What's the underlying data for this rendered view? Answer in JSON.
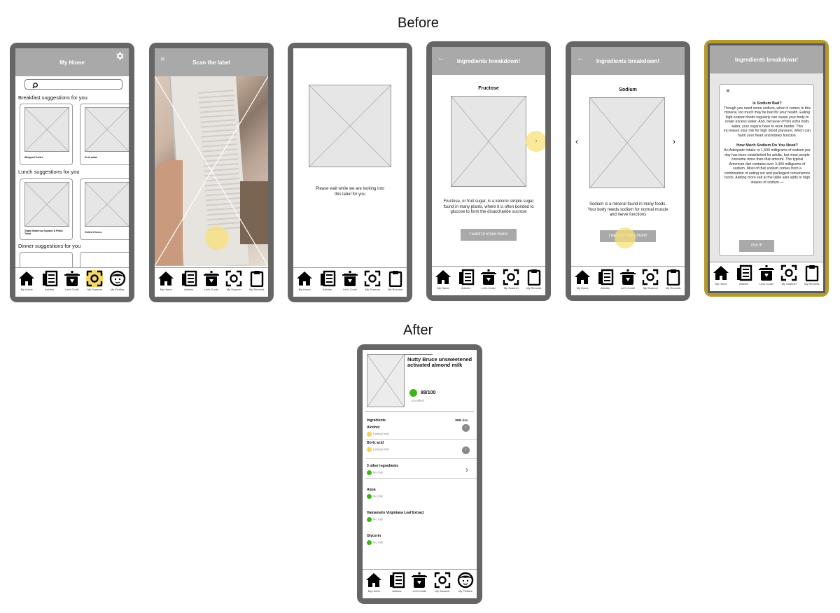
{
  "headings": {
    "before": "Before",
    "after": "After"
  },
  "nav": {
    "home": "My Home",
    "articles": "Articles",
    "cook": "Let's Cook!",
    "scanner": "My Scanner",
    "profiles": "My Profiles",
    "records": "My Records"
  },
  "screens": {
    "home": {
      "title": "My Home",
      "breakfast": "Breakfast suggestions for you",
      "lunch": "Lunch suggestions for you",
      "dinner": "Dinner suggestions for you",
      "breakfast_items": [
        "Whipped Coffee",
        "Fruit salad"
      ],
      "lunch_items": [
        "Vegan Butternut Squash & Pistio Toast",
        "Grilled Cheese"
      ]
    },
    "scan": {
      "title": "Scan the label",
      "close": "×"
    },
    "loading": {
      "message": "Please wait while we are looking into this label for you"
    },
    "fructose": {
      "title": "Ingredients breakdown!",
      "back": "←",
      "name": "Fructose",
      "description": "Fructose, or fruit sugar, is a ketonic simple sugar found in many plants, where it is often bonded to glucose to form the disaccharide sucrose",
      "button": "I want to know more!",
      "arrow": "›"
    },
    "sodium": {
      "title": "Ingredients breakdown!",
      "back": "←",
      "name": "Sodium",
      "description": "Sodium is a mineral found in many foods. Your body needs sodium for normal muscle and nerve functions",
      "button": "I want to know more!",
      "prev": "‹",
      "next": "›"
    },
    "detail": {
      "title": "Ingredients breakdown!",
      "close": "×",
      "q1": "Is Sodium Bad?",
      "p1": "Though you need some sodium, when it comes to this mineral, too much may be bad for your health. Eating high-sodium foods regularly can cause your body to retain excess water. And, because of this extra body water, your organs have to work harder. This increases your risk for high blood pressure, which can harm your heart and kidney function.",
      "q2": "How Much Sodium Do You Need?",
      "p2": "An Adequate Intake or 1,500 milligrams of sodium per day has been established for adults, but most people consume more than that amount. The typical American diet contains over 3,400 milligrams of sodium. Most of that sodium comes from a combination of eating out and packaged convenience foods. Adding more salt at the table also adds to high intakes of sodium —",
      "button": "Got it!"
    },
    "after": {
      "product": "Nutty Bruce unsweetened activated almond milk",
      "score": "88/100",
      "rating": "Excellent",
      "ingredients_label": "Ingredients",
      "see_all": "SEE ALL",
      "info": "i",
      "items": [
        {
          "name": "Alcohol",
          "risk": "Limited risk",
          "color": "#f4cf5c"
        },
        {
          "name": "Boric acid",
          "risk": "Limited risk",
          "color": "#f4cf5c"
        },
        {
          "name": "3 other ingredients",
          "risk": "No risk",
          "color": "#3fb518"
        },
        {
          "name": "Aqua",
          "risk": "No risk",
          "color": "#3fb518"
        },
        {
          "name": "Hamamelis Virginiana Leaf Extract",
          "risk": "No risk",
          "color": "#3fb518"
        },
        {
          "name": "Glycerin",
          "risk": "No risk",
          "color": "#3fb518"
        }
      ],
      "chevron": "›"
    }
  }
}
